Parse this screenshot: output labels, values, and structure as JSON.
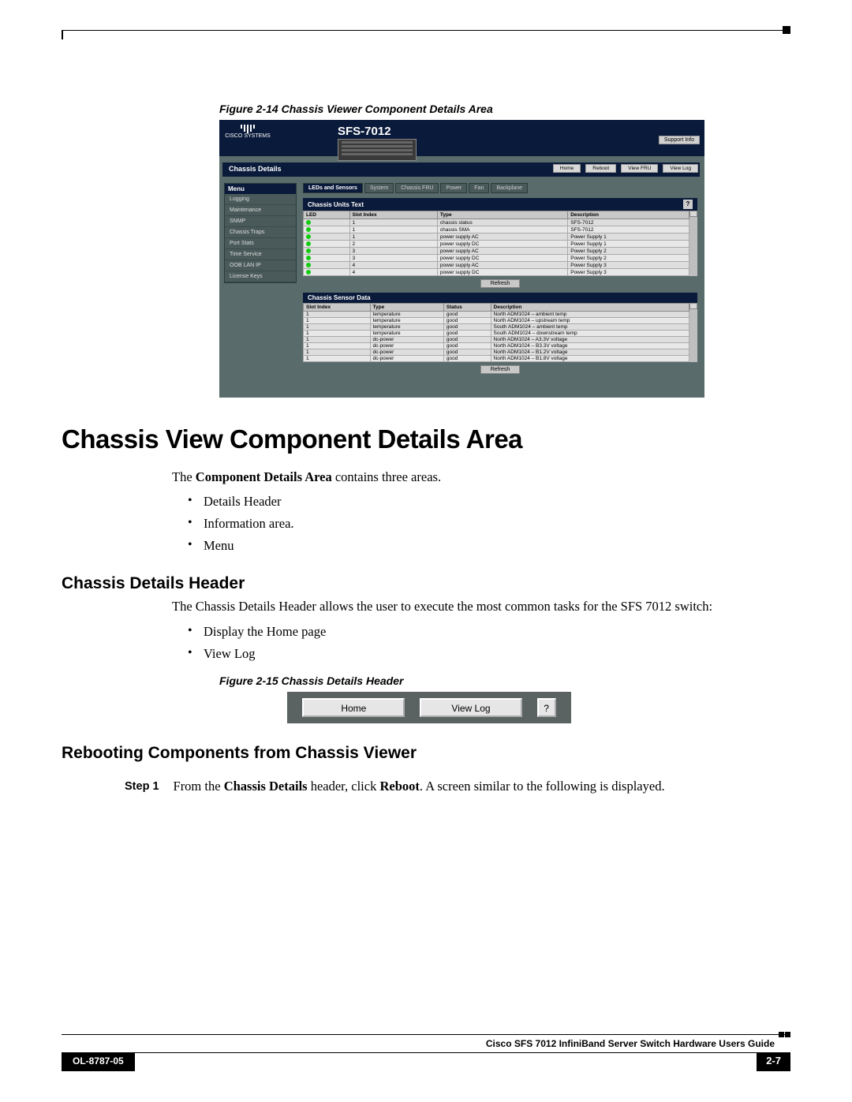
{
  "figure14": {
    "caption": "Figure 2-14   Chassis Viewer Component Details Area",
    "logo_text": "CISCO SYSTEMS",
    "product_title": "SFS-7012",
    "support_btn": "Support Info",
    "details_bar": "Chassis Details",
    "header_buttons": [
      "Home",
      "Reboot",
      "View FRU",
      "View Log"
    ],
    "menu_header": "Menu",
    "menu_items": [
      "Logging",
      "Maintenance",
      "SNMP",
      "Chassis Traps",
      "Port Stats",
      "Time Service",
      "OOB LAN IP",
      "License Keys"
    ],
    "tabs": [
      "LEDs and Sensors",
      "System",
      "Chassis FRU",
      "Power",
      "Fan",
      "Backplane"
    ],
    "panel1": {
      "title": "Chassis Units Text",
      "help": "?",
      "cols": [
        "LED",
        "Slot Index",
        "Type",
        "Description"
      ],
      "rows": [
        [
          "1",
          "chassis status",
          "SFS-7012"
        ],
        [
          "1",
          "chassis SMA",
          "SFS-7012"
        ],
        [
          "1",
          "power supply AC",
          "Power Supply 1"
        ],
        [
          "2",
          "power supply DC",
          "Power Supply 1"
        ],
        [
          "3",
          "power supply AC",
          "Power Supply 2"
        ],
        [
          "3",
          "power supply DC",
          "Power Supply 2"
        ],
        [
          "4",
          "power supply AC",
          "Power Supply 3"
        ],
        [
          "4",
          "power supply DC",
          "Power Supply 3"
        ]
      ],
      "refresh": "Refresh"
    },
    "panel2": {
      "title": "Chassis Sensor Data",
      "cols": [
        "Slot Index",
        "Type",
        "Status",
        "Description"
      ],
      "rows": [
        [
          "1",
          "temperature",
          "good",
          "North ADM1024 – ambient temp"
        ],
        [
          "1",
          "temperature",
          "good",
          "North ADM1024 – upstream temp"
        ],
        [
          "1",
          "temperature",
          "good",
          "South ADM1024 – ambient temp"
        ],
        [
          "1",
          "temperature",
          "good",
          "South ADM1024 – downstream temp"
        ],
        [
          "1",
          "dc-power",
          "good",
          "North ADM1024 – A3.3V voltage"
        ],
        [
          "1",
          "dc-power",
          "good",
          "North ADM1024 – B3.3V voltage"
        ],
        [
          "1",
          "dc-power",
          "good",
          "North ADM1024 – B1.2V voltage"
        ],
        [
          "1",
          "dc-power",
          "good",
          "North ADM1024 – B1.8V voltage"
        ]
      ],
      "refresh": "Refresh"
    }
  },
  "h1": "Chassis View Component Details Area",
  "p1a": "The ",
  "p1b": "Component Details Area",
  "p1c": " contains three areas.",
  "bullets1": [
    "Details Header",
    "Information area.",
    "Menu"
  ],
  "h2a": "Chassis Details Header",
  "p2": "The Chassis Details Header allows the user to execute the most common tasks for the SFS 7012 switch:",
  "bullets2": [
    "Display the Home page",
    "View Log"
  ],
  "figure15_caption": "Figure 2-15   Chassis Details Header",
  "figure15": {
    "home": "Home",
    "viewlog": "View Log",
    "help": "?"
  },
  "h2b": "Rebooting Components from Chassis Viewer",
  "step1_label": "Step 1",
  "step1a": "From the ",
  "step1b": "Chassis Details",
  "step1c": " header, click ",
  "step1d": "Reboot",
  "step1e": ". A screen similar to the following is displayed.",
  "footer": {
    "guide": "Cisco SFS 7012 InfiniBand Server Switch Hardware Users Guide",
    "doc": "OL-8787-05",
    "page": "2-7"
  }
}
